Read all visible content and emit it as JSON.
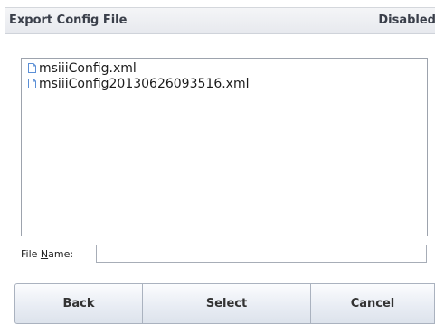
{
  "header": {
    "title": "Export Config File",
    "status": "Disabled"
  },
  "files": [
    {
      "name": "msiiiConfig.xml",
      "icon": "file-icon"
    },
    {
      "name": "msiiiConfig20130626093516.xml",
      "icon": "file-icon"
    }
  ],
  "filename": {
    "label_pre": "File ",
    "label_mnemonic": "N",
    "label_post": "ame:",
    "value": "",
    "placeholder": ""
  },
  "buttons": {
    "back": "Back",
    "select": "Select",
    "cancel": "Cancel"
  },
  "colors": {
    "header_bg": "#e7e9ee",
    "list_border": "#9da3ad",
    "icon_stroke": "#5b8fd6"
  }
}
